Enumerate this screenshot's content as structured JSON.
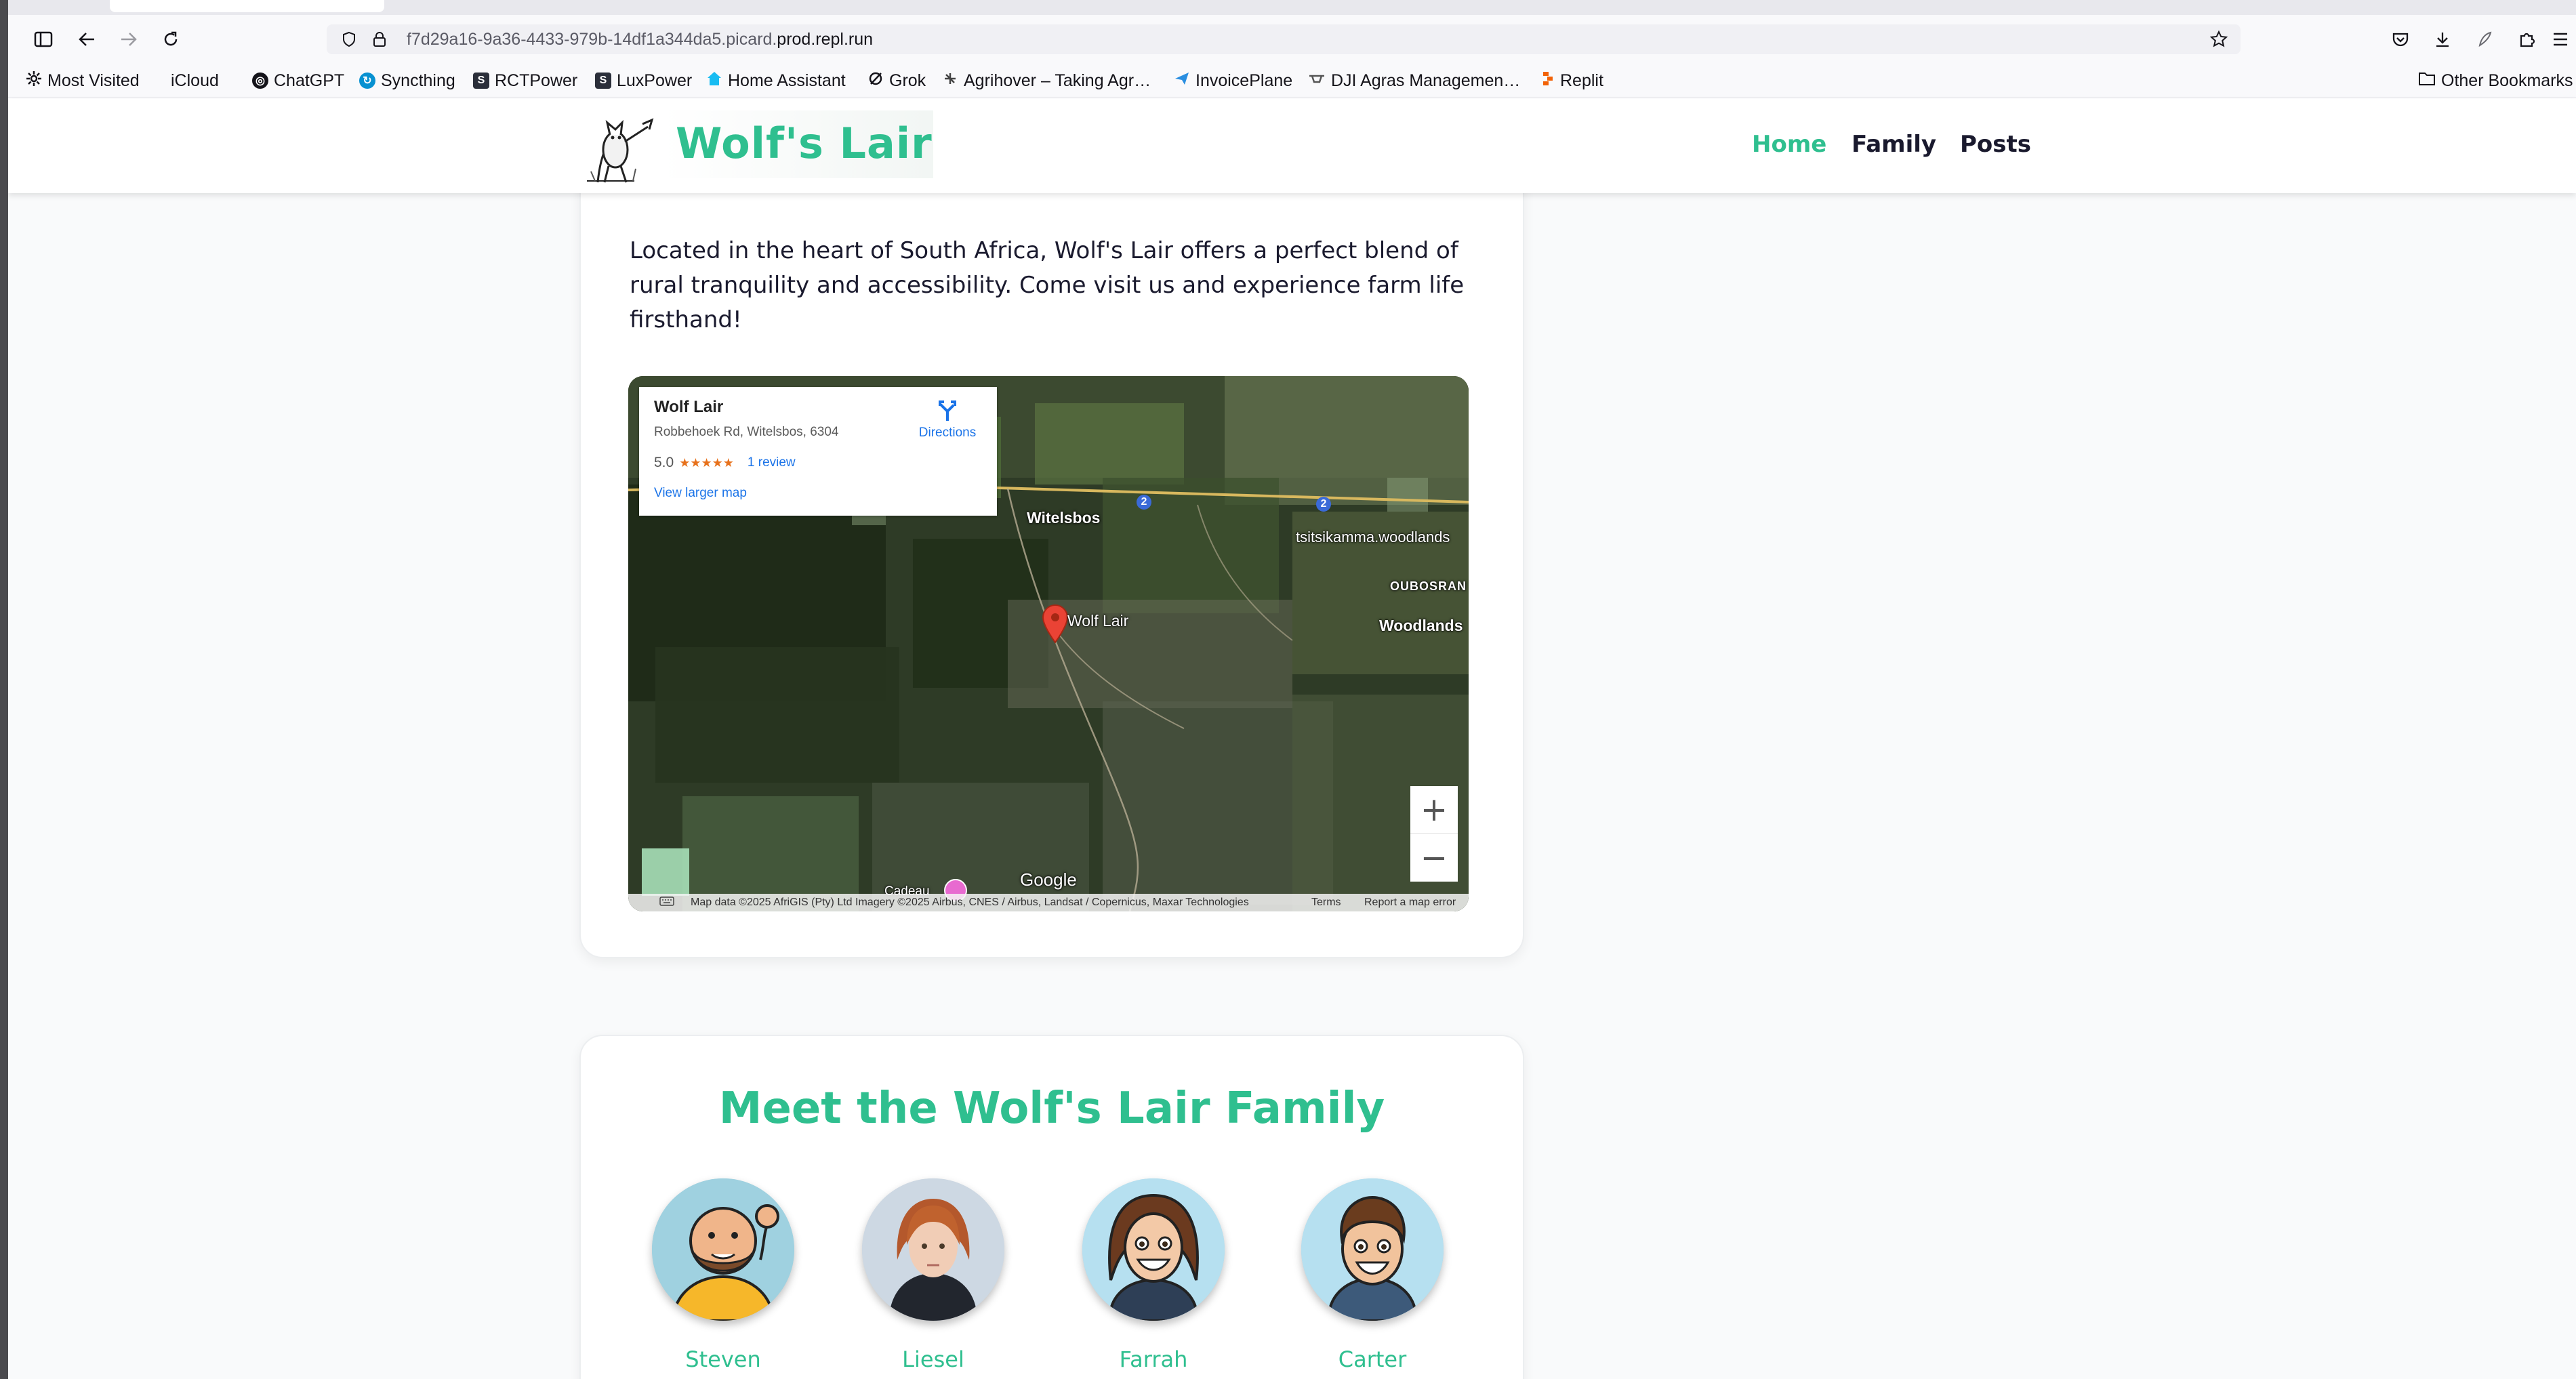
{
  "browser": {
    "url_prefix": "f7d29a16-9a36-4433-979b-14df1a344da5.picard.",
    "url_domain": "prod.repl.run",
    "bookmarks": [
      {
        "label": "Most Visited",
        "icon": "gear-icon"
      },
      {
        "label": "iCloud",
        "icon": "apple-icon"
      },
      {
        "label": "ChatGPT",
        "icon": "chatgpt-icon"
      },
      {
        "label": "Syncthing",
        "icon": "syncthing-icon"
      },
      {
        "label": "RCTPower",
        "icon": "rctpower-icon"
      },
      {
        "label": "LuxPower",
        "icon": "luxpower-icon"
      },
      {
        "label": "Home Assistant",
        "icon": "home-assistant-icon"
      },
      {
        "label": "Grok",
        "icon": "grok-icon"
      },
      {
        "label": "Agrihover – Taking Agr…",
        "icon": "agrihover-icon"
      },
      {
        "label": "InvoicePlane",
        "icon": "invoiceplane-icon"
      },
      {
        "label": "DJI Agras Managemen…",
        "icon": "dji-icon"
      },
      {
        "label": "Replit",
        "icon": "replit-icon"
      }
    ],
    "other_bookmarks": "Other Bookmarks"
  },
  "site": {
    "brand": "Wolf's Lair",
    "nav": [
      {
        "label": "Home",
        "active": true
      },
      {
        "label": "Family",
        "active": false
      },
      {
        "label": "Posts",
        "active": false
      }
    ],
    "accent_color": "#2fbf8f"
  },
  "location": {
    "paragraph": "Located in the heart of South Africa, Wolf's Lair offers a perfect blend of rural tranquility and accessibility. Come visit us and experience farm life firsthand!"
  },
  "map": {
    "place_name": "Wolf Lair",
    "address": "Robbehoek Rd, Witelsbos, 6304",
    "rating": "5.0",
    "stars": "★★★★★",
    "reviews": "1 review",
    "view_larger": "View larger map",
    "directions": "Directions",
    "labels": {
      "witelsbos": "Witelsbos",
      "road": "tsitsikamma.woodlands",
      "oubosrand": "OUBOSRAN",
      "woodlands": "Woodlands",
      "pin": "Wolf Lair",
      "cadeau": "Cadeau",
      "route_marker": "2"
    },
    "google": "Google",
    "attribution": "Map data ©2025 AfriGIS (Pty) Ltd Imagery ©2025 Airbus, CNES / Airbus, Landsat / Copernicus, Maxar Technologies",
    "terms": "Terms",
    "report": "Report a map error",
    "zoom_in": "+",
    "zoom_out": "−"
  },
  "family": {
    "heading": "Meet the Wolf's Lair Family",
    "members": [
      {
        "name": "Steven"
      },
      {
        "name": "Liesel"
      },
      {
        "name": "Farrah"
      },
      {
        "name": "Carter"
      }
    ]
  }
}
